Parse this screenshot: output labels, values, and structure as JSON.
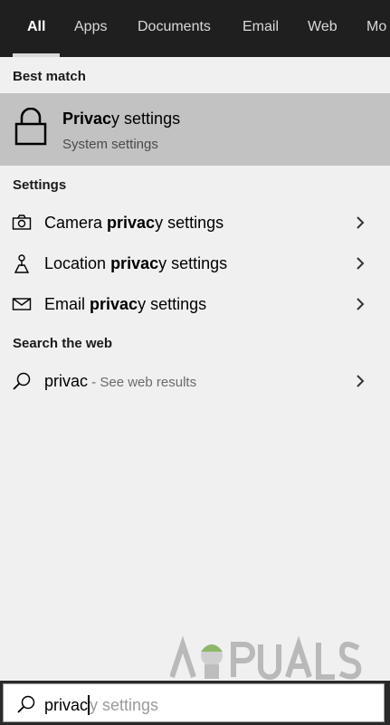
{
  "tabs": [
    {
      "label": "All",
      "active": true
    },
    {
      "label": "Apps"
    },
    {
      "label": "Documents"
    },
    {
      "label": "Email"
    },
    {
      "label": "Web"
    },
    {
      "label": "Mo"
    }
  ],
  "best_match": {
    "header": "Best match",
    "title_bold": "Privac",
    "title_rest": "y settings",
    "subtitle": "System settings",
    "icon": "lock-icon"
  },
  "settings": {
    "header": "Settings",
    "items": [
      {
        "icon": "camera-icon",
        "pre": "Camera ",
        "bold": "privac",
        "post": "y settings"
      },
      {
        "icon": "location-icon",
        "pre": "Location ",
        "bold": "privac",
        "post": "y settings"
      },
      {
        "icon": "email-icon",
        "pre": "Email ",
        "bold": "privac",
        "post": "y settings"
      }
    ]
  },
  "web": {
    "header": "Search the web",
    "query": "privac",
    "suffix": " - See web results",
    "icon": "search-icon"
  },
  "watermark": {
    "text": "APPUALS"
  },
  "search": {
    "typed": "privac",
    "ghost": "y settings"
  },
  "colors": {
    "topbar": "#1f1f1f",
    "selected": "#c2c2c2",
    "panel": "#f0f0f0"
  }
}
